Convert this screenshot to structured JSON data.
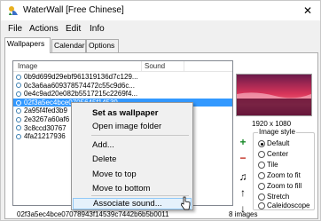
{
  "window": {
    "title": "WaterWall [Free Chinese]",
    "close_glyph": "✕"
  },
  "menubar": {
    "items": [
      "File",
      "Actions",
      "Edit",
      "Info"
    ]
  },
  "tabs": [
    {
      "label": "Wallpapers",
      "active": true
    },
    {
      "label": "Calendar",
      "active": false
    },
    {
      "label": "Options",
      "active": false
    }
  ],
  "list": {
    "columns": [
      "Image",
      "Sound"
    ],
    "rows": [
      {
        "text": "0b9d699d29ebf961319136d7c129...",
        "selected": false
      },
      {
        "text": "0c3a6aa609378574472c55c9d6c...",
        "selected": false
      },
      {
        "text": "0e4c9ad20e082b5517215c2269f4...",
        "selected": false
      },
      {
        "text": "02f3a5ec4bce0705645f14539...",
        "selected": true
      },
      {
        "text": "2a95f4fed3b9",
        "selected": false
      },
      {
        "text": "2e3267a60af6",
        "selected": false
      },
      {
        "text": "3c8ccd30767",
        "selected": false
      },
      {
        "text": "4fa21217936",
        "selected": false
      }
    ]
  },
  "preview": {
    "resolution": "1920 x 1080"
  },
  "image_style": {
    "title": "Image style",
    "options": [
      {
        "label": "Default",
        "selected": true
      },
      {
        "label": "Center",
        "selected": false
      },
      {
        "label": "Tile",
        "selected": false
      },
      {
        "label": "Zoom to fit",
        "selected": false
      },
      {
        "label": "Zoom to fill",
        "selected": false
      },
      {
        "label": "Stretch",
        "selected": false
      },
      {
        "label": "Caleidoscope",
        "selected": false
      }
    ]
  },
  "side_buttons": [
    {
      "icon": "plus-icon",
      "glyph": "+",
      "color": "#1a8a2a"
    },
    {
      "icon": "minus-icon",
      "glyph": "−",
      "color": "#c0281c"
    },
    {
      "icon": "music-note-icon",
      "glyph": "♫",
      "color": "#000000"
    },
    {
      "icon": "arrow-up-icon",
      "glyph": "↑",
      "color": "#000000"
    },
    {
      "icon": "arrow-down-icon",
      "glyph": "↓",
      "color": "#000000"
    }
  ],
  "context_menu": {
    "items": [
      {
        "label": "Set as wallpaper",
        "bold": true
      },
      {
        "label": "Open image folder"
      },
      {
        "label": "Add..."
      },
      {
        "label": "Delete"
      },
      {
        "label": "Move to top"
      },
      {
        "label": "Move to bottom"
      },
      {
        "label": "Associate sound...",
        "hover": true
      }
    ]
  },
  "status": {
    "filename": "02f3a5ec4bce07078943f14539c7442b6b5b0011",
    "count": "8 images"
  },
  "colors": {
    "selection": "#3399ff",
    "menu_hover": "#e5f1fb",
    "add_green": "#1a8a2a",
    "delete_red": "#c0281c"
  }
}
